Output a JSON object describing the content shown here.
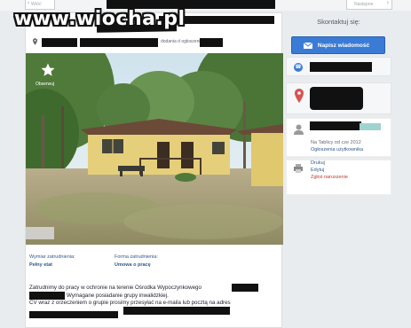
{
  "watermark": "www.wiocha.pl",
  "nav": {
    "prev_label": "Wróć",
    "next_label": "Następne"
  },
  "listing": {
    "posted_fragment": "dodania d ogłoszenia",
    "photo_fav_label": "Obserwuj",
    "employment_type_label": "Wymiar zatrudnienia:",
    "employment_type_value": "Pełny etat",
    "contract_label": "Forma zatrudnienia:",
    "contract_value": "Umowa o pracę",
    "description_lines": [
      "Zatrudnimy do pracy w ochronie na terenie Ośrodka Wypoczynkowego",
      "Wymagane posiadanie grupy inwalidzkiej.",
      "CV wraz z orzeczeniem o grupie prosimy przesyłać na e-maila lub pocztą na adres"
    ]
  },
  "sidebar": {
    "title": "Skontaktuj się:",
    "send_message_label": "Napisz wiadomość",
    "user_since": "Na Tablicy od cze 2012",
    "user_ads_link": "Ogłoszenia użytkownika",
    "print_link": "Drukuj",
    "edit_link": "Edytuj",
    "report_link": "Zgłoś naruszenie"
  },
  "colors": {
    "accent": "#3a7bd5",
    "link": "#2e5a8b",
    "danger": "#c0392b"
  }
}
